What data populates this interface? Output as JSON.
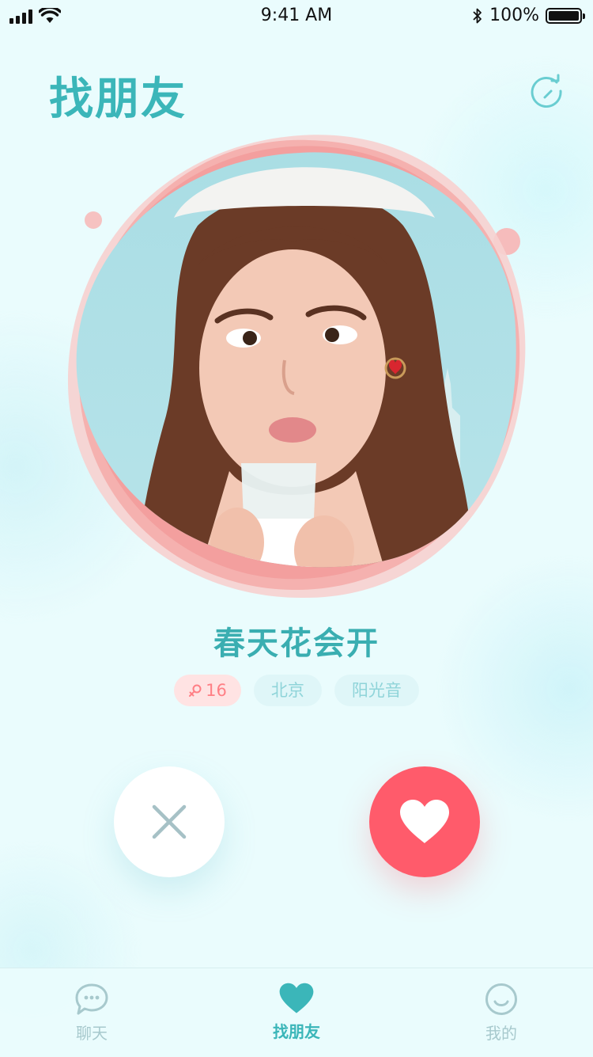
{
  "status_bar": {
    "time": "9:41 AM",
    "battery": "100%"
  },
  "header": {
    "title": "找朋友"
  },
  "profile": {
    "name": "春天花会开",
    "tags": {
      "age": "16",
      "city": "北京",
      "trait": "阳光音"
    }
  },
  "tabbar": {
    "items": [
      {
        "label": "聊天",
        "icon": "chat-bubble-icon"
      },
      {
        "label": "找朋友",
        "icon": "heart-icon"
      },
      {
        "label": "我的",
        "icon": "smiley-face-icon"
      }
    ],
    "active": "找朋友"
  },
  "colors": {
    "accent": "#3bb6b9",
    "like": "#ff5b6b",
    "tag_pink": "#ffe3e3",
    "tag_blue": "#dff6f8"
  }
}
